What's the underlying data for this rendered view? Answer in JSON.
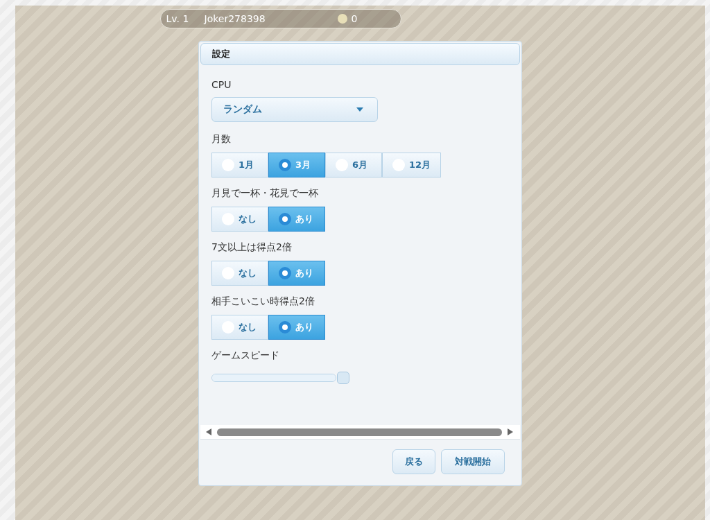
{
  "status_bar": {
    "level_text": "Lv. 1",
    "player": "Joker278398",
    "coins": "0"
  },
  "dialog": {
    "title": "設定",
    "settings": [
      {
        "kind": "select",
        "label": "CPU",
        "value": "ランダム"
      },
      {
        "kind": "radio",
        "label": "月数",
        "options": [
          {
            "label": "1月",
            "selected": false
          },
          {
            "label": "3月",
            "selected": true
          },
          {
            "label": "6月",
            "selected": false
          },
          {
            "label": "12月",
            "selected": false
          }
        ]
      },
      {
        "kind": "radio",
        "label": "月見で一杯・花見で一杯",
        "options": [
          {
            "label": "なし",
            "selected": false
          },
          {
            "label": "あり",
            "selected": true
          }
        ]
      },
      {
        "kind": "radio",
        "label": "7文以上は得点2倍",
        "options": [
          {
            "label": "なし",
            "selected": false
          },
          {
            "label": "あり",
            "selected": true
          }
        ]
      },
      {
        "kind": "radio",
        "label": "相手こいこい時得点2倍",
        "options": [
          {
            "label": "なし",
            "selected": false
          },
          {
            "label": "あり",
            "selected": true
          }
        ]
      },
      {
        "kind": "slider",
        "label": "ゲームスピード",
        "level": 1
      }
    ],
    "buttons": [
      "戻る",
      "対戦開始"
    ]
  }
}
